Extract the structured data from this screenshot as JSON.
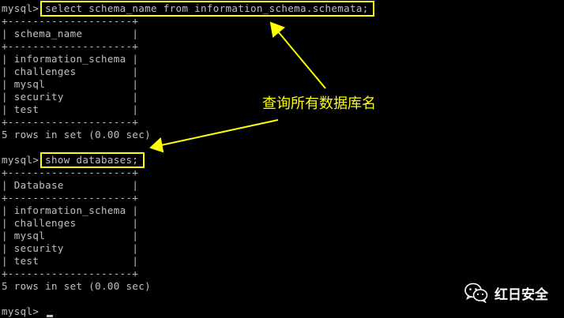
{
  "terminal": {
    "lines": [
      "mysql> select schema_name from information_schema.schemata;",
      "+--------------------+",
      "| schema_name        |",
      "+--------------------+",
      "| information_schema |",
      "| challenges         |",
      "| mysql              |",
      "| security           |",
      "| test               |",
      "+--------------------+",
      "5 rows in set (0.00 sec)",
      "",
      "mysql> show databases;",
      "+--------------------+",
      "| Database           |",
      "+--------------------+",
      "| information_schema |",
      "| challenges         |",
      "| mysql              |",
      "| security           |",
      "| test               |",
      "+--------------------+",
      "5 rows in set (0.00 sec)",
      "",
      "mysql> "
    ]
  },
  "annotation": {
    "text": "查询所有数据库名"
  },
  "watermark": {
    "icon": "wechat-icon",
    "text": "红日安全"
  },
  "colors": {
    "background": "#000000",
    "text": "#c0c0c0",
    "highlight": "#ffff00",
    "watermark": "#ffffff"
  }
}
